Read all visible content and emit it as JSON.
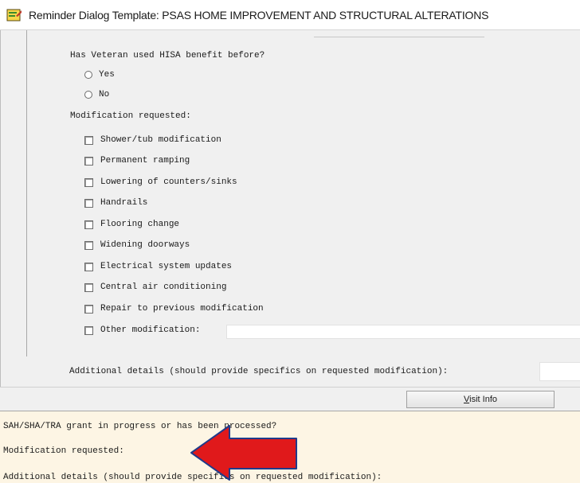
{
  "window": {
    "title": "Reminder Dialog Template: PSAS HOME IMPROVEMENT AND STRUCTURAL ALTERATIONS",
    "icon": "reminder-dialog-icon"
  },
  "dialog": {
    "hisa_question": "Has Veteran used HISA benefit before?",
    "hisa_options": [
      {
        "label": "Yes",
        "selected": false
      },
      {
        "label": "No",
        "selected": false
      }
    ],
    "modification_label": "Modification requested:",
    "modifications": [
      {
        "label": "Shower/tub modification",
        "checked": false
      },
      {
        "label": "Permanent ramping",
        "checked": false
      },
      {
        "label": "Lowering of counters/sinks",
        "checked": false
      },
      {
        "label": "Handrails",
        "checked": false
      },
      {
        "label": "Flooring change",
        "checked": false
      },
      {
        "label": "Widening doorways",
        "checked": false
      },
      {
        "label": "Electrical system updates",
        "checked": false
      },
      {
        "label": "Central air conditioning",
        "checked": false
      },
      {
        "label": "Repair to previous modification",
        "checked": false
      },
      {
        "label": "Other modification:",
        "checked": false
      }
    ],
    "additional_details_label": "Additional details (should provide specifics on requested modification):"
  },
  "buttons": {
    "visit_info_label": "Visit Info",
    "visit_info_hotkey": "V"
  },
  "preview": {
    "lines": [
      "SAH/SHA/TRA grant in progress or has been processed?",
      "Modification requested:",
      "Additional details (should provide specifics on requested modification):"
    ]
  },
  "annotation": {
    "arrow_color": "#e0191b",
    "arrow_outline": "#1f3a8a"
  }
}
